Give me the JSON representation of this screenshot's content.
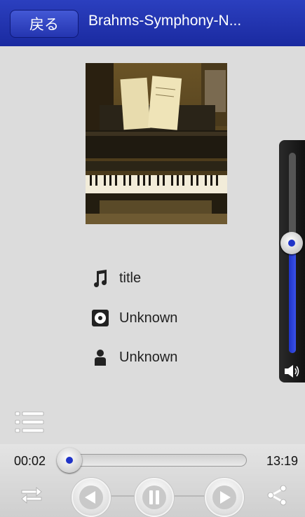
{
  "nav": {
    "back_label": "戻る",
    "title": "Brahms-Symphony-N..."
  },
  "track": {
    "title": "title",
    "album": "Unknown",
    "artist": "Unknown"
  },
  "playback": {
    "elapsed": "00:02",
    "duration": "13:19",
    "progress": 0.003,
    "volume": 0.55,
    "state": "playing"
  },
  "colors": {
    "header": "#1f30b0",
    "accent": "#1f33c8",
    "background": "#dcdcdc"
  },
  "icons": {
    "title": "music-note-icon",
    "album": "disc-icon",
    "artist": "person-icon",
    "list": "list-icon",
    "shuffle": "shuffle-icon",
    "previous": "previous-icon",
    "pause": "pause-icon",
    "next": "next-icon",
    "share": "share-icon",
    "speaker": "speaker-icon"
  }
}
